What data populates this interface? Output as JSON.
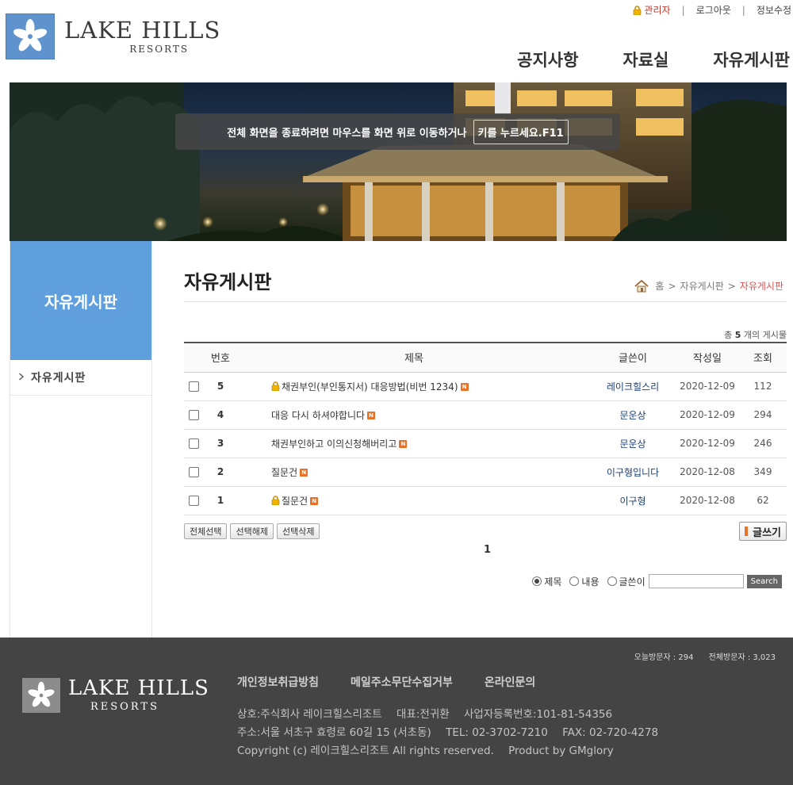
{
  "header": {
    "logo": {
      "main": "LAKE HILLS",
      "sub": "RESORTS"
    },
    "util": {
      "admin": "관리자",
      "logout": "로그아웃",
      "profile": "정보수정"
    },
    "gnb": [
      "공지사항",
      "자료실",
      "자유게시판"
    ]
  },
  "banner": {
    "fullscreen_msg": "전체 화면을 종료하려면 마우스를 화면 위로 이동하거나",
    "fullscreen_key": "키를 누르세요.F11"
  },
  "lnb": {
    "title": "자유게시판",
    "items": [
      "자유게시판"
    ]
  },
  "board": {
    "title": "자유게시판",
    "breadcrumb": {
      "home": "홈",
      "parent": "자유게시판",
      "current": "자유게시판"
    },
    "total": {
      "prefix": "총",
      "count": "5",
      "suffix": "개의 게시물"
    },
    "columns": {
      "num": "번호",
      "subject": "제목",
      "writer": "글쓴이",
      "date": "작성일",
      "hits": "조회"
    },
    "rows": [
      {
        "num": "5",
        "subject": "채권부인(부인통지서) 대응방법(비번 1234)",
        "locked": true,
        "writer": "레이크힐스리",
        "date": "2020-12-09",
        "hits": "112"
      },
      {
        "num": "4",
        "subject": "대응 다시 하셔야합니다",
        "locked": false,
        "writer": "문운상",
        "date": "2020-12-09",
        "hits": "294"
      },
      {
        "num": "3",
        "subject": "채권부인하고 이의신청해버리고",
        "locked": false,
        "writer": "문운상",
        "date": "2020-12-09",
        "hits": "246"
      },
      {
        "num": "2",
        "subject": "질문건",
        "locked": false,
        "writer": "이구형입니다",
        "date": "2020-12-08",
        "hits": "349"
      },
      {
        "num": "1",
        "subject": "질문건",
        "locked": true,
        "writer": "이구형",
        "date": "2020-12-08",
        "hits": "62"
      }
    ],
    "new_badge": "N",
    "buttons": {
      "select_all": "전체선택",
      "deselect": "선택해제",
      "delete": "선택삭제",
      "write": "글쓰기"
    },
    "paging": {
      "current": "1"
    },
    "search": {
      "options": [
        "제목",
        "내용",
        "글쓴이"
      ],
      "selected": "제목",
      "button": "Search",
      "value": ""
    }
  },
  "footer": {
    "visits": {
      "today": "오늘방문자 : 294",
      "total": "전체방문자 : 3,023"
    },
    "links": [
      "개인정보취급방침",
      "메일주소무단수집거부",
      "온라인문의"
    ],
    "info": {
      "company": "상호:주식회사 레이크힐스리조트",
      "ceo": "대표:전귀환",
      "biz_no": "사업자등록번호:101-81-54356",
      "address": "주소:서울 서초구 효령로 60길 15 (서초동)",
      "tel": "TEL: 02-3702-7210",
      "fax": "FAX: 02-720-4278",
      "copyright": "Copyright (c) 레이크힐스리조트 All rights reserved.",
      "product": "Product by GMglory"
    }
  },
  "colors": {
    "accent": "#5f9fdd",
    "breadcrumb_current": "#d9534f",
    "writer_link": "#1c3f76",
    "footer_bg": "#444444"
  }
}
